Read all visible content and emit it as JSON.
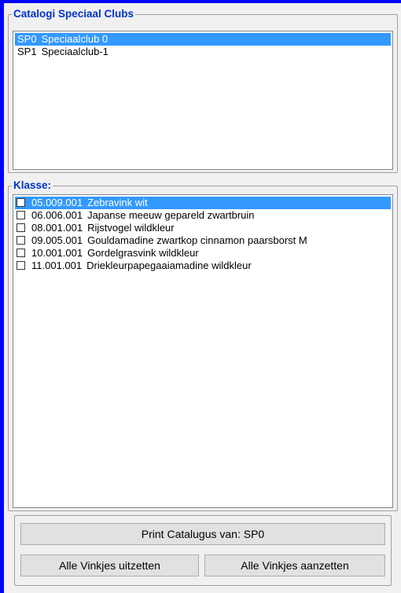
{
  "clubs_group": {
    "title": "Catalogi Speciaal Clubs",
    "items": [
      {
        "code": "SP0",
        "name": "Speciaalclub 0",
        "selected": true
      },
      {
        "code": "SP1",
        "name": "Speciaalclub-1",
        "selected": false
      }
    ]
  },
  "classes_group": {
    "title": "Klasse:",
    "items": [
      {
        "code": "05.009.001",
        "name": "Zebravink wit",
        "selected": true,
        "checked": false
      },
      {
        "code": "06.006.001",
        "name": "Japanse meeuw gepareld zwartbruin",
        "selected": false,
        "checked": false
      },
      {
        "code": "08.001.001",
        "name": "Rijstvogel wildkleur",
        "selected": false,
        "checked": false
      },
      {
        "code": "09.005.001",
        "name": "Gouldamadine zwartkop cinnamon paarsborst M",
        "selected": false,
        "checked": false
      },
      {
        "code": "10.001.001",
        "name": "Gordelgrasvink wildkleur",
        "selected": false,
        "checked": false
      },
      {
        "code": "11.001.001",
        "name": "Driekleurpapegaaiamadine wildkleur",
        "selected": false,
        "checked": false
      }
    ]
  },
  "buttons": {
    "print_label": "Print Catalugus van: SP0",
    "uncheck_all_label": "Alle Vinkjes uitzetten",
    "check_all_label": "Alle Vinkjes aanzetten"
  },
  "colors": {
    "frame": "#0000ff",
    "selection": "#3399ff",
    "group_title": "#0033cc"
  }
}
